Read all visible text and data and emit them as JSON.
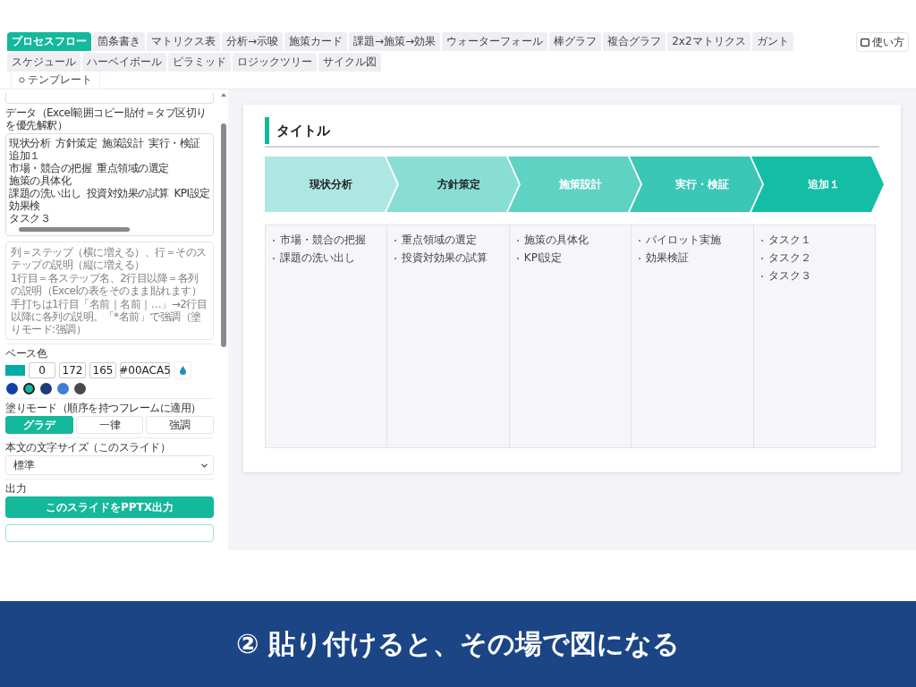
{
  "tabs": [
    {
      "label": "プロセスフロー",
      "selected": true
    },
    {
      "label": "箇条書き",
      "selected": false
    },
    {
      "label": "マトリクス表",
      "selected": false
    },
    {
      "label": "分析→示唆",
      "selected": false
    },
    {
      "label": "施策カード",
      "selected": false
    },
    {
      "label": "課題→施策→効果",
      "selected": false
    },
    {
      "label": "ウォーターフォール",
      "selected": false
    },
    {
      "label": "棒グラフ",
      "selected": false
    },
    {
      "label": "複合グラフ",
      "selected": false
    },
    {
      "label": "2x2マトリクス",
      "selected": false
    },
    {
      "label": "ガント",
      "selected": false
    },
    {
      "label": "スケジュール",
      "selected": false
    },
    {
      "label": "ハーベイボール",
      "selected": false
    },
    {
      "label": "ピラミッド",
      "selected": false
    },
    {
      "label": "ロジックツリー",
      "selected": false
    },
    {
      "label": "サイクル図",
      "selected": false
    }
  ],
  "help_button": {
    "label": "使い方"
  },
  "template_button": {
    "label": "テンプレート"
  },
  "sidebar": {
    "data_label": "データ（Excel範囲コピー貼付＝タブ区切りを優先解釈）",
    "data_rows": [
      [
        "現状分析",
        "方針策定",
        "施策設計",
        "実行・検証",
        "追加１"
      ],
      [
        "市場・競合の把握",
        "重点領域の選定",
        "施策の具体化"
      ],
      [
        "課題の洗い出し",
        "投資対効果の試算",
        "KPI設定",
        "効果検"
      ],
      [
        "タスク３"
      ]
    ],
    "help_lines": [
      "列＝ステップ（横に増える）、行＝そのステップの説明（縦に増える）",
      "1行目＝各ステップ名、2行目以降＝各列の説明（Excelの表をそのまま貼れます）",
      "手打ちは1行目「名前｜名前｜…」→2行目以降に各列の説明。「*名前」で強調（塗りモード:強調）"
    ],
    "base_color": {
      "label": "ベース色",
      "color": "#00aca5",
      "r": "0",
      "g": "172",
      "b": "165",
      "hex": "#00ACA5"
    },
    "palette": [
      {
        "color": "#123fa8",
        "selected": false
      },
      {
        "color": "#14b89b",
        "selected": true
      },
      {
        "color": "#1a3d78",
        "selected": false
      },
      {
        "color": "#3b80d6",
        "selected": false
      },
      {
        "color": "#4a4a4a",
        "selected": false
      }
    ],
    "fill_mode": {
      "label": "塗りモード（順序を持つフレームに適用）",
      "options": [
        {
          "label": "グラデ",
          "selected": true
        },
        {
          "label": "一律",
          "selected": false
        },
        {
          "label": "強調",
          "selected": false
        }
      ]
    },
    "font_size": {
      "label": "本文の文字サイズ（このスライド）",
      "value": "標準"
    },
    "output": {
      "label": "出力",
      "button": "このスライドをPPTX出力"
    }
  },
  "slide": {
    "title": "タイトル",
    "steps": [
      {
        "name": "現状分析",
        "color": "#ade7e1",
        "items": [
          "市場・競合の把握",
          "課題の洗い出し"
        ]
      },
      {
        "name": "方針策定",
        "color": "#88ded4",
        "items": [
          "重点領域の選定",
          "投資対効果の試算"
        ]
      },
      {
        "name": "施策設計",
        "color": "#5ed2c3",
        "items": [
          "施策の具体化",
          "KPI設定"
        ]
      },
      {
        "name": "実行・検証",
        "color": "#3ac7b5",
        "items": [
          "パイロット実施",
          "効果検証"
        ]
      },
      {
        "name": "追加１",
        "color": "#14bea5",
        "items": [
          "タスク１",
          "タスク２",
          "タスク３"
        ]
      }
    ]
  },
  "caption": "② 貼り付けると、その場で図になる"
}
